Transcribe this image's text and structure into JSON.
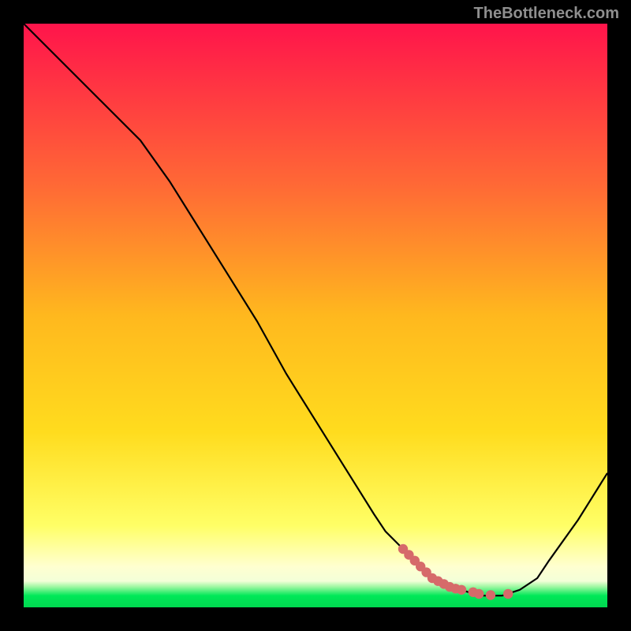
{
  "attribution": "TheBottleneck.com",
  "colors": {
    "frame": "#000000",
    "gradient_top": "#ff144b",
    "gradient_mid_upper": "#ff8a2e",
    "gradient_mid": "#ffdc1e",
    "gradient_lower": "#ffff66",
    "gradient_pale": "#ffffd0",
    "gradient_green": "#00e858",
    "curve": "#000000",
    "markers": "#d66a6a"
  },
  "chart_data": {
    "type": "line",
    "title": "",
    "xlabel": "",
    "ylabel": "",
    "xlim": [
      0,
      100
    ],
    "ylim": [
      0,
      100
    ],
    "series": [
      {
        "name": "bottleneck-curve",
        "x": [
          0,
          5,
          10,
          15,
          20,
          25,
          30,
          35,
          40,
          45,
          50,
          55,
          60,
          62,
          65,
          68,
          70,
          72,
          75,
          78,
          80,
          82,
          85,
          88,
          90,
          95,
          100
        ],
        "y": [
          100,
          95,
          90,
          85,
          80,
          73,
          65,
          57,
          49,
          40,
          32,
          24,
          16,
          13,
          10,
          7,
          5,
          4,
          3,
          2,
          2,
          2,
          3,
          5,
          8,
          15,
          23
        ]
      }
    ],
    "markers": [
      {
        "x": 65,
        "y": 10
      },
      {
        "x": 66,
        "y": 9
      },
      {
        "x": 67,
        "y": 8
      },
      {
        "x": 68,
        "y": 7
      },
      {
        "x": 69,
        "y": 6
      },
      {
        "x": 70,
        "y": 5
      },
      {
        "x": 71,
        "y": 4.5
      },
      {
        "x": 72,
        "y": 4
      },
      {
        "x": 73,
        "y": 3.5
      },
      {
        "x": 74,
        "y": 3.2
      },
      {
        "x": 75,
        "y": 3
      },
      {
        "x": 77,
        "y": 2.6
      },
      {
        "x": 78,
        "y": 2.3
      },
      {
        "x": 80,
        "y": 2.1
      },
      {
        "x": 83,
        "y": 2.3
      }
    ],
    "annotations": []
  }
}
